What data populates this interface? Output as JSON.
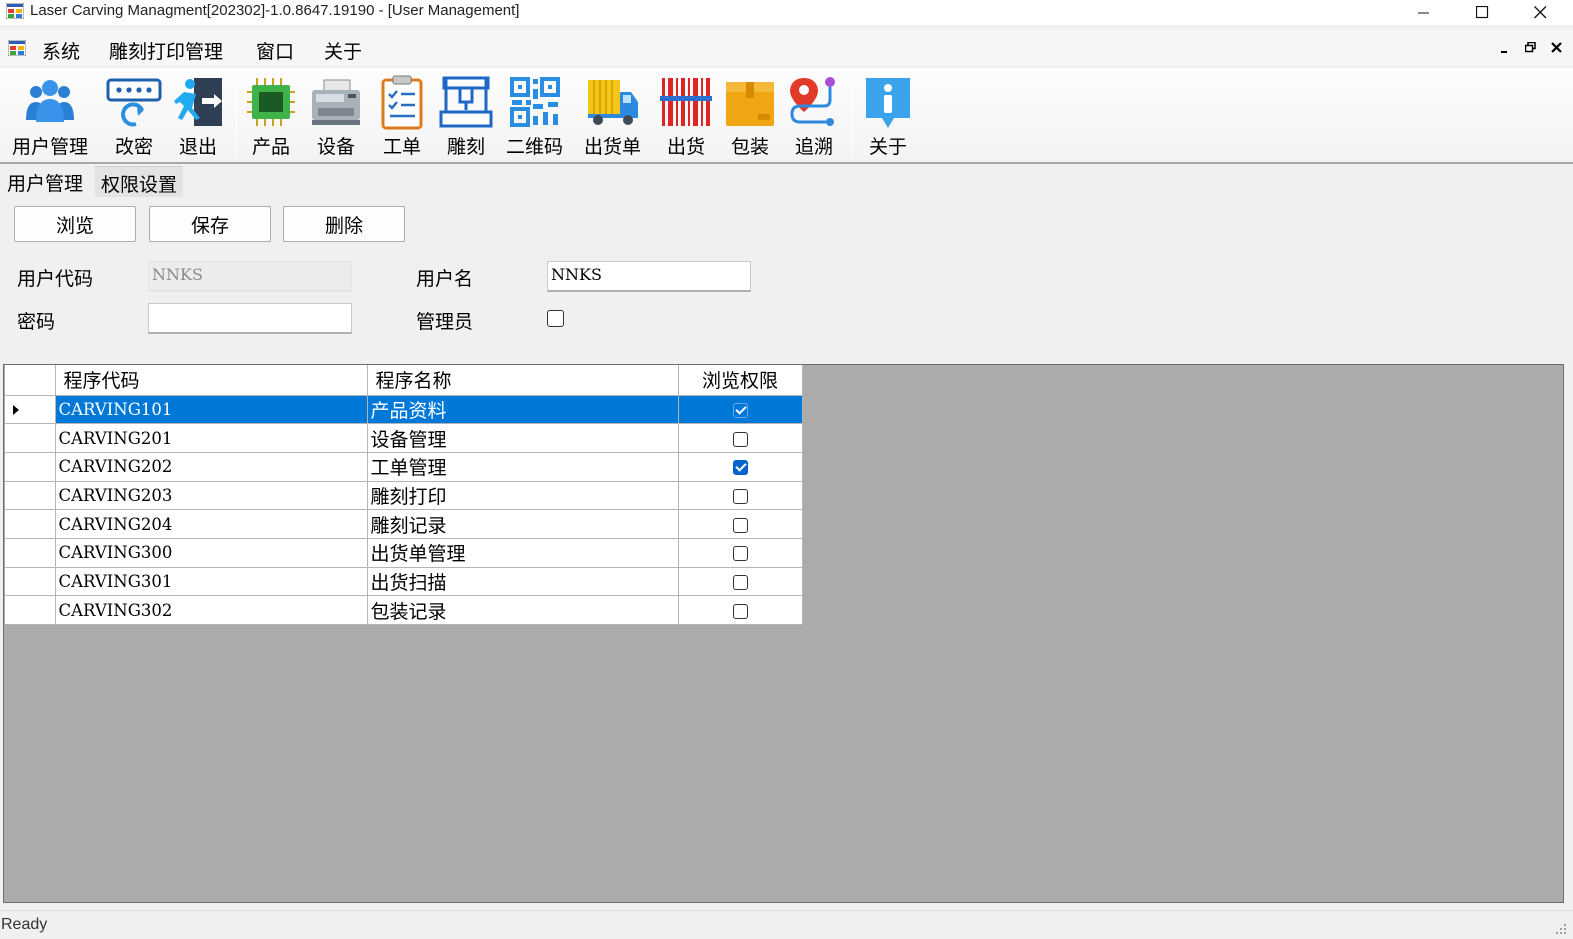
{
  "window": {
    "title": "Laser Carving Managment[202302]-1.0.8647.19190 - [User Management]",
    "controls": [
      "minimize",
      "maximize",
      "close"
    ]
  },
  "menubar": {
    "items": [
      "系统",
      "雕刻打印管理",
      "窗口",
      "关于"
    ],
    "mdi_controls": [
      "minimize",
      "restore",
      "close"
    ]
  },
  "toolbar": {
    "buttons": [
      {
        "label": "用户管理",
        "icon": "users-icon"
      },
      {
        "label": "改密",
        "icon": "password-change-icon"
      },
      {
        "label": "退出",
        "icon": "exit-icon"
      },
      {
        "label": "产品",
        "icon": "chip-icon"
      },
      {
        "label": "设备",
        "icon": "printer-machine-icon"
      },
      {
        "label": "工单",
        "icon": "clipboard-icon"
      },
      {
        "label": "雕刻",
        "icon": "engraver-icon"
      },
      {
        "label": "二维码",
        "icon": "qrcode-icon"
      },
      {
        "label": "出货单",
        "icon": "truck-icon"
      },
      {
        "label": "出货",
        "icon": "barcode-icon"
      },
      {
        "label": "包装",
        "icon": "box-icon"
      },
      {
        "label": "追溯",
        "icon": "route-icon"
      },
      {
        "label": "关于",
        "icon": "info-icon"
      }
    ]
  },
  "tabs": [
    {
      "label": "用户管理",
      "active": false
    },
    {
      "label": "权限设置",
      "active": true
    }
  ],
  "actions": {
    "browse": "浏览",
    "save": "保存",
    "delete": "删除"
  },
  "form": {
    "user_code_label": "用户代码",
    "user_code_value": "NNKS",
    "user_name_label": "用户名",
    "user_name_value": "NNKS",
    "password_label": "密码",
    "password_value": "",
    "admin_label": "管理员",
    "admin_checked": false
  },
  "grid": {
    "columns": [
      "程序代码",
      "程序名称",
      "浏览权限"
    ],
    "rows": [
      {
        "code": "CARVING101",
        "name": "产品资料",
        "browse": true,
        "selected": true
      },
      {
        "code": "CARVING201",
        "name": "设备管理",
        "browse": false,
        "selected": false
      },
      {
        "code": "CARVING202",
        "name": "工单管理",
        "browse": true,
        "selected": false
      },
      {
        "code": "CARVING203",
        "name": "雕刻打印",
        "browse": false,
        "selected": false
      },
      {
        "code": "CARVING204",
        "name": "雕刻记录",
        "browse": false,
        "selected": false
      },
      {
        "code": "CARVING300",
        "name": "出货单管理",
        "browse": false,
        "selected": false
      },
      {
        "code": "CARVING301",
        "name": "出货扫描",
        "browse": false,
        "selected": false
      },
      {
        "code": "CARVING302",
        "name": "包装记录",
        "browse": false,
        "selected": false
      }
    ]
  },
  "status": {
    "text": "Ready"
  },
  "colors": {
    "selection": "#0078d7",
    "grid_background": "#ababab",
    "checkbox_checked": "#0063c9"
  }
}
